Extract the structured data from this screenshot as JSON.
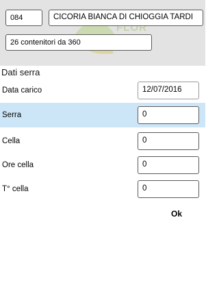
{
  "header": {
    "code": "084",
    "product_name": "CICORIA BIANCA DI CHIOGGIA   TARDI",
    "quantity": "26 contenitori da 360",
    "watermark_text": "FLOR"
  },
  "section_title": "Dati serra",
  "fields": [
    {
      "label": "Data carico",
      "value": "12/07/2016"
    },
    {
      "label": "Serra",
      "value": "0"
    },
    {
      "label": "Cella",
      "value": "0"
    },
    {
      "label": "Ore cella",
      "value": "0"
    },
    {
      "label": "T° cella",
      "value": "0"
    }
  ],
  "ok_label": "Ok",
  "colors": {
    "header_bg": "#e3e3e3",
    "selected_row": "#cde6f7"
  }
}
